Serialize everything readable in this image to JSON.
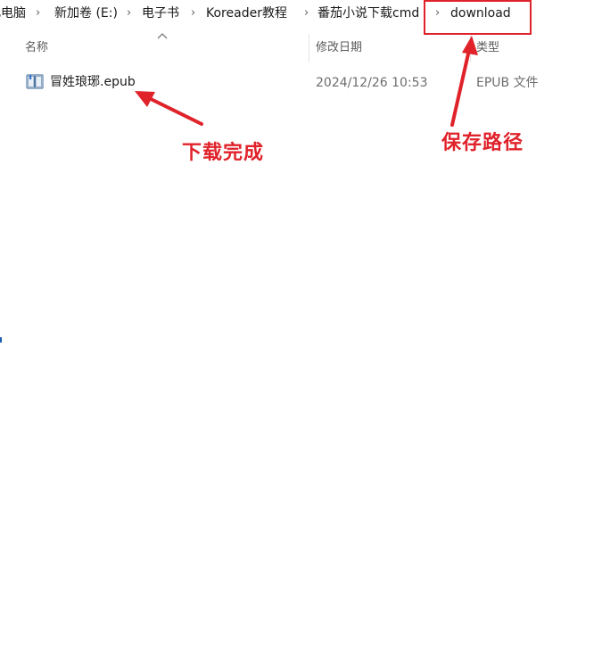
{
  "breadcrumb": {
    "items": [
      {
        "label": "此电脑"
      },
      {
        "label": "新加卷 (E:)"
      },
      {
        "label": "电子书"
      },
      {
        "label": "Koreader教程"
      },
      {
        "label": "番茄小说下载cmd"
      },
      {
        "label": "download"
      }
    ],
    "separator": "›"
  },
  "columns": {
    "name": "名称",
    "modified": "修改日期",
    "type": "类型"
  },
  "files": [
    {
      "name": "冒姓琅琊.epub",
      "modified": "2024/12/26 10:53",
      "type": "EPUB 文件",
      "icon": "book-icon"
    }
  ],
  "annotations": {
    "download_done": "下载完成",
    "save_path": "保存路径",
    "color": "#e0222a"
  }
}
